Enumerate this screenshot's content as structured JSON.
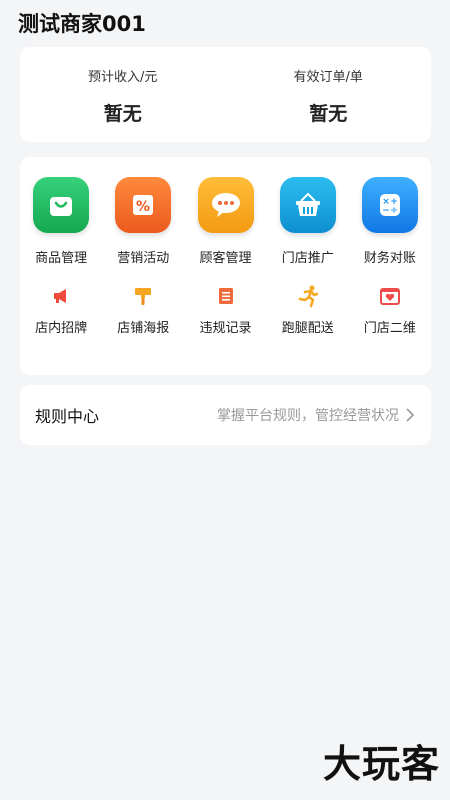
{
  "header": {
    "title": "测试商家001"
  },
  "stats": [
    {
      "label": "预计收入/元",
      "value": "暂无"
    },
    {
      "label": "有效订单/单",
      "value": "暂无"
    }
  ],
  "features_primary": [
    {
      "label": "商品管理",
      "icon": "shopping-bag-icon",
      "color": "#1fb960"
    },
    {
      "label": "营销活动",
      "icon": "discount-ticket-icon",
      "color": "#f26a2b"
    },
    {
      "label": "顾客管理",
      "icon": "chat-bubble-icon",
      "color": "#f7a51f"
    },
    {
      "label": "门店推广",
      "icon": "basket-icon",
      "color": "#14a3dc"
    },
    {
      "label": "财务对账",
      "icon": "calculator-icon",
      "color": "#1891f0"
    }
  ],
  "features_secondary": [
    {
      "label": "店内招牌",
      "icon": "megaphone-icon",
      "color": "#ef4b3c"
    },
    {
      "label": "店铺海报",
      "icon": "paint-brush-icon",
      "color": "#f5a623"
    },
    {
      "label": "违规记录",
      "icon": "list-doc-icon",
      "color": "#ef6a3a"
    },
    {
      "label": "跑腿配送",
      "icon": "runner-icon",
      "color": "#f5a623"
    },
    {
      "label": "门店二维",
      "icon": "qr-heart-icon",
      "color": "#ef4b4b"
    }
  ],
  "rules": {
    "title": "规则中心",
    "desc": "掌握平台规则，管控经营状况"
  },
  "watermark": "大玩客"
}
